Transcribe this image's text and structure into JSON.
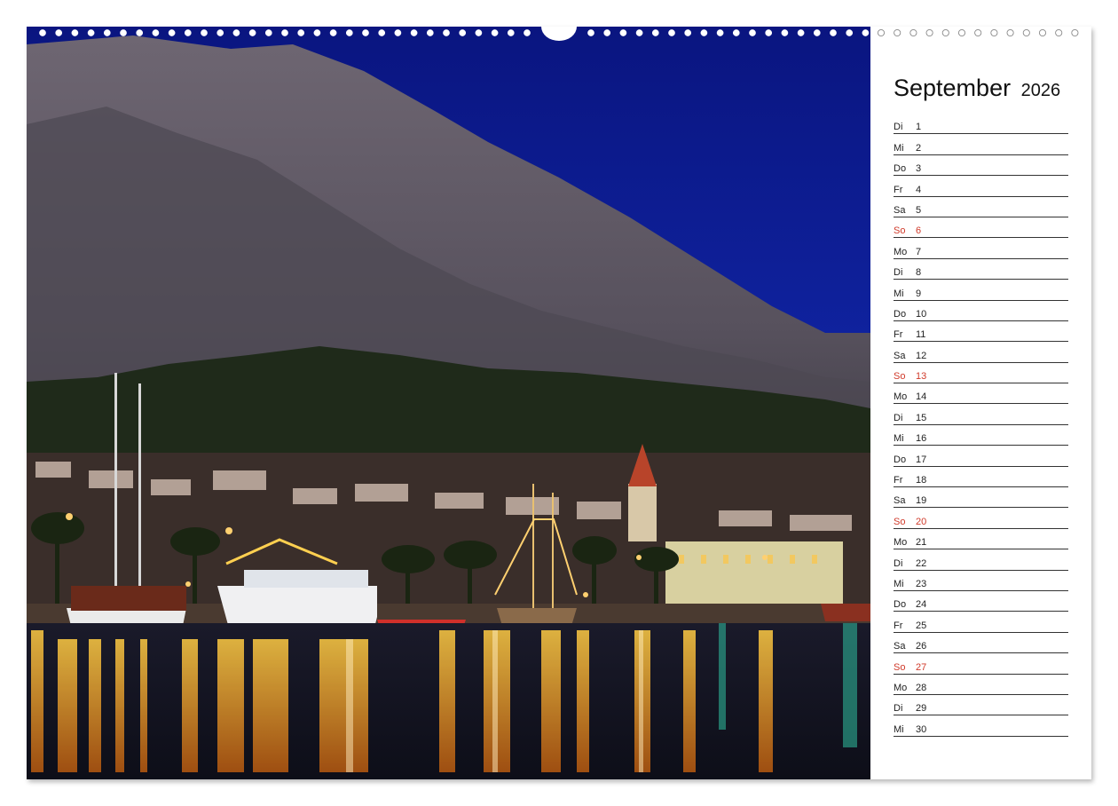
{
  "calendar": {
    "month": "September",
    "year": "2026",
    "days": [
      {
        "name": "Di",
        "num": "1",
        "sunday": false
      },
      {
        "name": "Mi",
        "num": "2",
        "sunday": false
      },
      {
        "name": "Do",
        "num": "3",
        "sunday": false
      },
      {
        "name": "Fr",
        "num": "4",
        "sunday": false
      },
      {
        "name": "Sa",
        "num": "5",
        "sunday": false
      },
      {
        "name": "So",
        "num": "6",
        "sunday": true
      },
      {
        "name": "Mo",
        "num": "7",
        "sunday": false
      },
      {
        "name": "Di",
        "num": "8",
        "sunday": false
      },
      {
        "name": "Mi",
        "num": "9",
        "sunday": false
      },
      {
        "name": "Do",
        "num": "10",
        "sunday": false
      },
      {
        "name": "Fr",
        "num": "11",
        "sunday": false
      },
      {
        "name": "Sa",
        "num": "12",
        "sunday": false
      },
      {
        "name": "So",
        "num": "13",
        "sunday": true
      },
      {
        "name": "Mo",
        "num": "14",
        "sunday": false
      },
      {
        "name": "Di",
        "num": "15",
        "sunday": false
      },
      {
        "name": "Mi",
        "num": "16",
        "sunday": false
      },
      {
        "name": "Do",
        "num": "17",
        "sunday": false
      },
      {
        "name": "Fr",
        "num": "18",
        "sunday": false
      },
      {
        "name": "Sa",
        "num": "19",
        "sunday": false
      },
      {
        "name": "So",
        "num": "20",
        "sunday": true
      },
      {
        "name": "Mo",
        "num": "21",
        "sunday": false
      },
      {
        "name": "Di",
        "num": "22",
        "sunday": false
      },
      {
        "name": "Mi",
        "num": "23",
        "sunday": false
      },
      {
        "name": "Do",
        "num": "24",
        "sunday": false
      },
      {
        "name": "Fr",
        "num": "25",
        "sunday": false
      },
      {
        "name": "Sa",
        "num": "26",
        "sunday": false
      },
      {
        "name": "So",
        "num": "27",
        "sunday": true
      },
      {
        "name": "Mo",
        "num": "28",
        "sunday": false
      },
      {
        "name": "Di",
        "num": "29",
        "sunday": false
      },
      {
        "name": "Mi",
        "num": "30",
        "sunday": false
      }
    ]
  },
  "colors": {
    "sunday": "#d03a2a",
    "sky": "#0b1a8a",
    "mountain": "#5a5560",
    "water_reflection": "#f0a020"
  },
  "photo": {
    "icon": "harbor-night-photo"
  }
}
